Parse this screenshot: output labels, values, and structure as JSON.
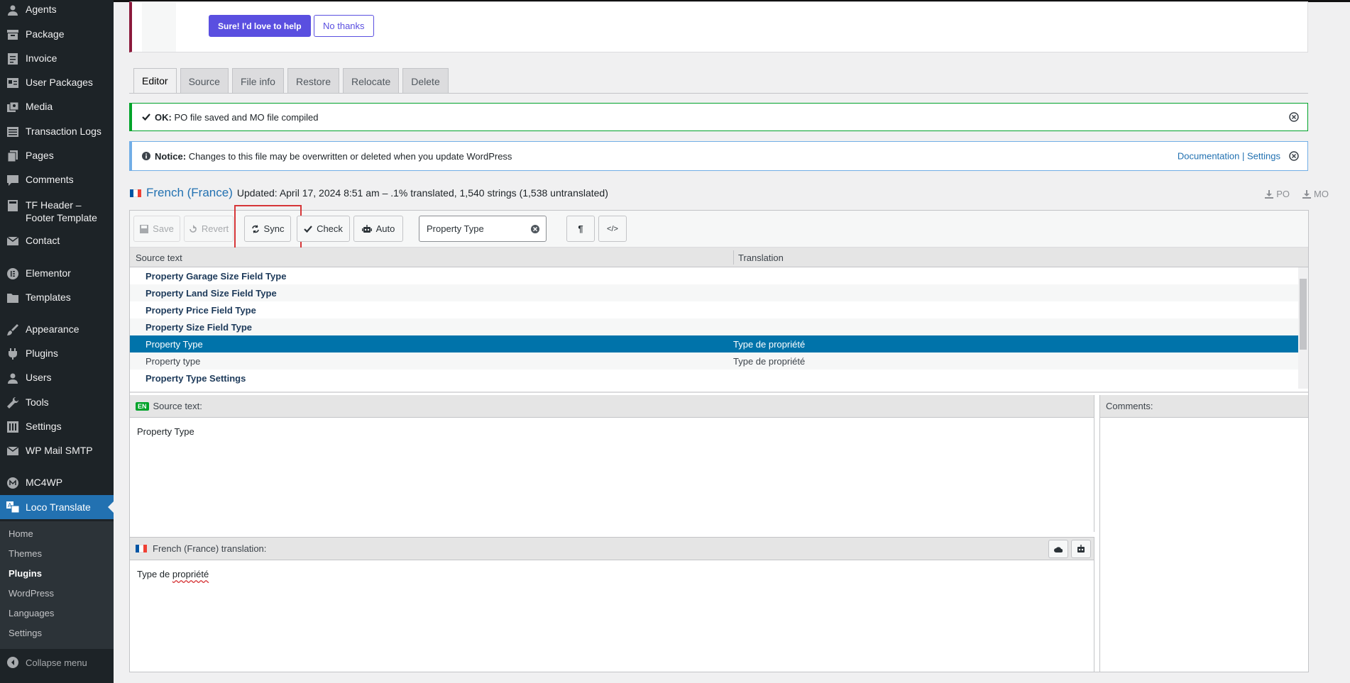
{
  "sidebar": {
    "items": [
      {
        "label": "Agents",
        "icon": "user-icon"
      },
      {
        "label": "Package",
        "icon": "package-icon"
      },
      {
        "label": "Invoice",
        "icon": "invoice-icon"
      },
      {
        "label": "User Packages",
        "icon": "card-icon"
      },
      {
        "label": "Media",
        "icon": "media-icon"
      },
      {
        "label": "Transaction Logs",
        "icon": "log-icon"
      },
      {
        "label": "Pages",
        "icon": "pages-icon"
      },
      {
        "label": "Comments",
        "icon": "comment-icon"
      },
      {
        "label": "TF Header – Footer Template",
        "icon": "template-icon"
      },
      {
        "label": "Contact",
        "icon": "mail-icon"
      },
      {
        "label": "Elementor",
        "icon": "elementor-icon"
      },
      {
        "label": "Templates",
        "icon": "folder-icon"
      },
      {
        "label": "Appearance",
        "icon": "brush-icon"
      },
      {
        "label": "Plugins",
        "icon": "plugin-icon"
      },
      {
        "label": "Users",
        "icon": "users-icon"
      },
      {
        "label": "Tools",
        "icon": "wrench-icon"
      },
      {
        "label": "Settings",
        "icon": "settings-icon"
      },
      {
        "label": "WP Mail SMTP",
        "icon": "mail-icon"
      },
      {
        "label": "MC4WP",
        "icon": "mc4wp-icon"
      },
      {
        "label": "Loco Translate",
        "icon": "translate-icon"
      }
    ],
    "submenu": [
      "Home",
      "Themes",
      "Plugins",
      "WordPress",
      "Languages",
      "Settings"
    ],
    "collapse": "Collapse menu"
  },
  "promo": {
    "yes": "Sure! I'd love to help",
    "no": "No thanks"
  },
  "tabs": [
    "Editor",
    "Source",
    "File info",
    "Restore",
    "Relocate",
    "Delete"
  ],
  "notices": {
    "success_label": "OK:",
    "success_text": "PO file saved and MO file compiled",
    "info_label": "Notice:",
    "info_text": "Changes to this file may be overwritten or deleted when you update WordPress",
    "doc_link": "Documentation",
    "sep": "|",
    "settings_link": "Settings"
  },
  "locale": {
    "name": "French (France)",
    "status": "Updated: April 17, 2024 8:51 am – .1% translated, 1,540 strings (1,538 untranslated)",
    "po": "PO",
    "mo": "MO"
  },
  "toolbar": {
    "save": "Save",
    "revert": "Revert",
    "sync": "Sync",
    "check": "Check",
    "auto": "Auto",
    "search_value": "Property Type"
  },
  "list": {
    "col_source": "Source text",
    "col_translation": "Translation",
    "rows": [
      {
        "source": "Property Garage Size Field Type",
        "translation": ""
      },
      {
        "source": "Property Land Size Field Type",
        "translation": ""
      },
      {
        "source": "Property Price Field Type",
        "translation": ""
      },
      {
        "source": "Property Size Field Type",
        "translation": ""
      },
      {
        "source": "Property Type",
        "translation": "Type de propriété"
      },
      {
        "source": "Property type",
        "translation": "Type de propriété"
      },
      {
        "source": "Property Type Settings",
        "translation": ""
      }
    ]
  },
  "source_pane": {
    "badge": "EN",
    "label": "Source text:",
    "value": "Property Type"
  },
  "comments_pane": {
    "label": "Comments:"
  },
  "translation_pane": {
    "label": "French (France) translation:",
    "value_start": "Type de ",
    "value_word": "propriété"
  },
  "colors": {
    "accent": "#2271b1",
    "selected_row": "#0073aa",
    "sidebar": "#1d2327",
    "success": "#00a32a",
    "highlight": "#d63638"
  }
}
